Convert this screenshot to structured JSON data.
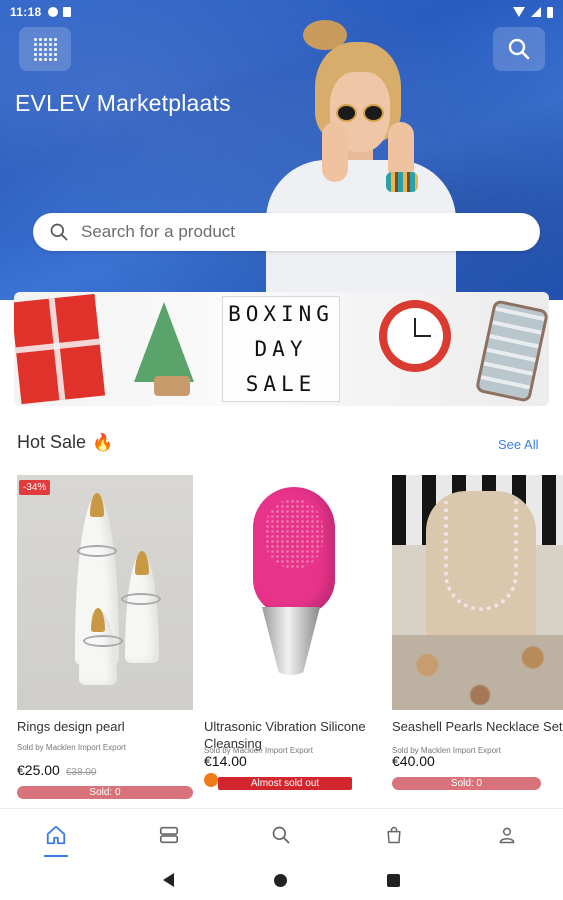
{
  "status_bar": {
    "time": "11:18"
  },
  "header": {
    "app_title": "EVLEV Marketplaats"
  },
  "search": {
    "placeholder": "Search for a product"
  },
  "banner": {
    "lines": [
      "BOXING",
      "DAY",
      "SALE"
    ]
  },
  "hot_sale": {
    "title": "Hot Sale",
    "see_all": "See All",
    "products": [
      {
        "name": "Rings design pearl",
        "seller": "Sold by Macklen Import Export",
        "price": "€25.00",
        "old_price": "€38.00",
        "discount": "-34%",
        "sold_label": "Sold: 0"
      },
      {
        "name": "Ultrasonic Vibration Silicone Cleansing",
        "seller": "Sold by Macklen Import Export",
        "price": "€14.00",
        "sold_label": "Almost sold out"
      },
      {
        "name": "Seashell Pearls Necklace Set",
        "seller": "Sold by Macklen Import Export",
        "price": "€40.00",
        "sold_label": "Sold: 0"
      }
    ]
  },
  "bottom_nav": {
    "items": [
      "home-icon",
      "categories-icon",
      "search-icon",
      "bag-icon",
      "profile-icon"
    ],
    "active": "home-icon"
  },
  "colors": {
    "accent": "#3b7ee6",
    "hero_blue": "#2f64c9",
    "sold_bar": "#d9737b",
    "alert_red": "#d2252e"
  }
}
